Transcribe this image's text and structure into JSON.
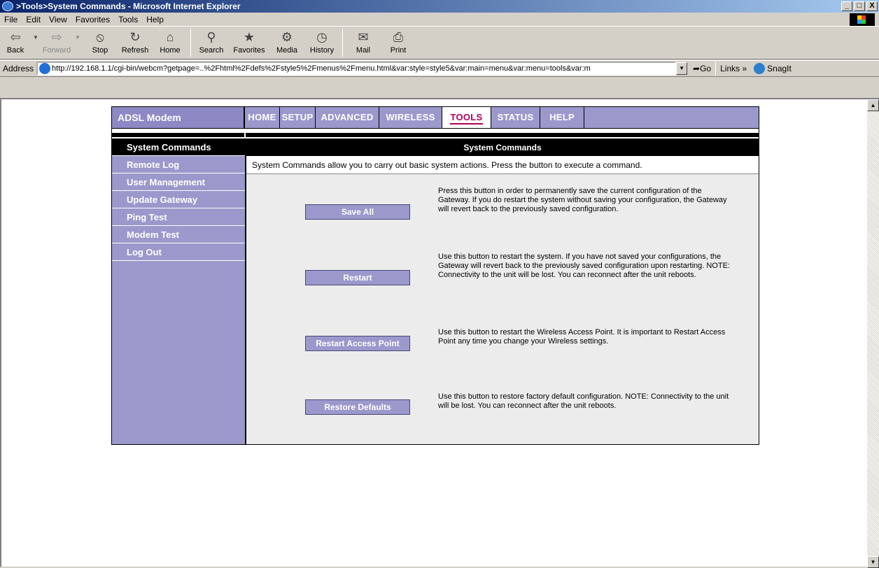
{
  "window": {
    "title": ">Tools>System Commands - Microsoft Internet Explorer",
    "controls": [
      "_",
      "□",
      "X"
    ]
  },
  "menubar": {
    "items": [
      "File",
      "Edit",
      "View",
      "Favorites",
      "Tools",
      "Help"
    ]
  },
  "toolbar": {
    "back": "Back",
    "forward": "Forward",
    "stop": "Stop",
    "refresh": "Refresh",
    "home": "Home",
    "search": "Search",
    "favorites": "Favorites",
    "media": "Media",
    "history": "History",
    "mail": "Mail",
    "print": "Print"
  },
  "addressbar": {
    "label": "Address",
    "url": "http://192.168.1.1/cgi-bin/webcm?getpage=..%2Fhtml%2Fdefs%2Fstyle5%2Fmenus%2Fmenu.html&var:style=style5&var:main=menu&var:menu=tools&var:m",
    "go": "Go",
    "links": "Links »",
    "snagit": "SnagIt"
  },
  "router": {
    "brand": "ADSL Modem",
    "nav": [
      {
        "label": "HOME",
        "active": false
      },
      {
        "label": "SETUP",
        "active": false
      },
      {
        "label": "ADVANCED",
        "active": false
      },
      {
        "label": "WIRELESS",
        "active": false
      },
      {
        "label": "TOOLS",
        "active": true
      },
      {
        "label": "STATUS",
        "active": false
      },
      {
        "label": "HELP",
        "active": false
      }
    ],
    "sidebar": [
      {
        "label": "System Commands",
        "active": true
      },
      {
        "label": "Remote Log",
        "active": false
      },
      {
        "label": "User Management",
        "active": false
      },
      {
        "label": "Update Gateway",
        "active": false
      },
      {
        "label": "Ping Test",
        "active": false
      },
      {
        "label": "Modem Test",
        "active": false
      },
      {
        "label": "Log Out",
        "active": false
      }
    ],
    "content": {
      "header": "System Commands",
      "description": "System Commands allow you to carry out basic system actions. Press the button to execute a command.",
      "commands": [
        {
          "button": "Save All",
          "text": "Press this button in order to permanently save the current configuration of the Gateway. If you do restart the system without saving your configuration, the Gateway will revert back to the previously saved configuration."
        },
        {
          "button": "Restart",
          "text": "Use this button to restart the system. If you have not saved your configurations, the Gateway will revert back to the previously saved configuration upon restarting. NOTE: Connectivity to the unit will be lost. You can reconnect after the unit reboots."
        },
        {
          "button": "Restart Access Point",
          "text": "Use this button to restart the Wireless Access Point. It is important to Restart Access Point any time you change your Wireless settings."
        },
        {
          "button": "Restore Defaults",
          "text": "Use this button to restore factory default configuration. NOTE: Connectivity to the unit will be lost. You can reconnect after the unit reboots."
        }
      ]
    }
  }
}
